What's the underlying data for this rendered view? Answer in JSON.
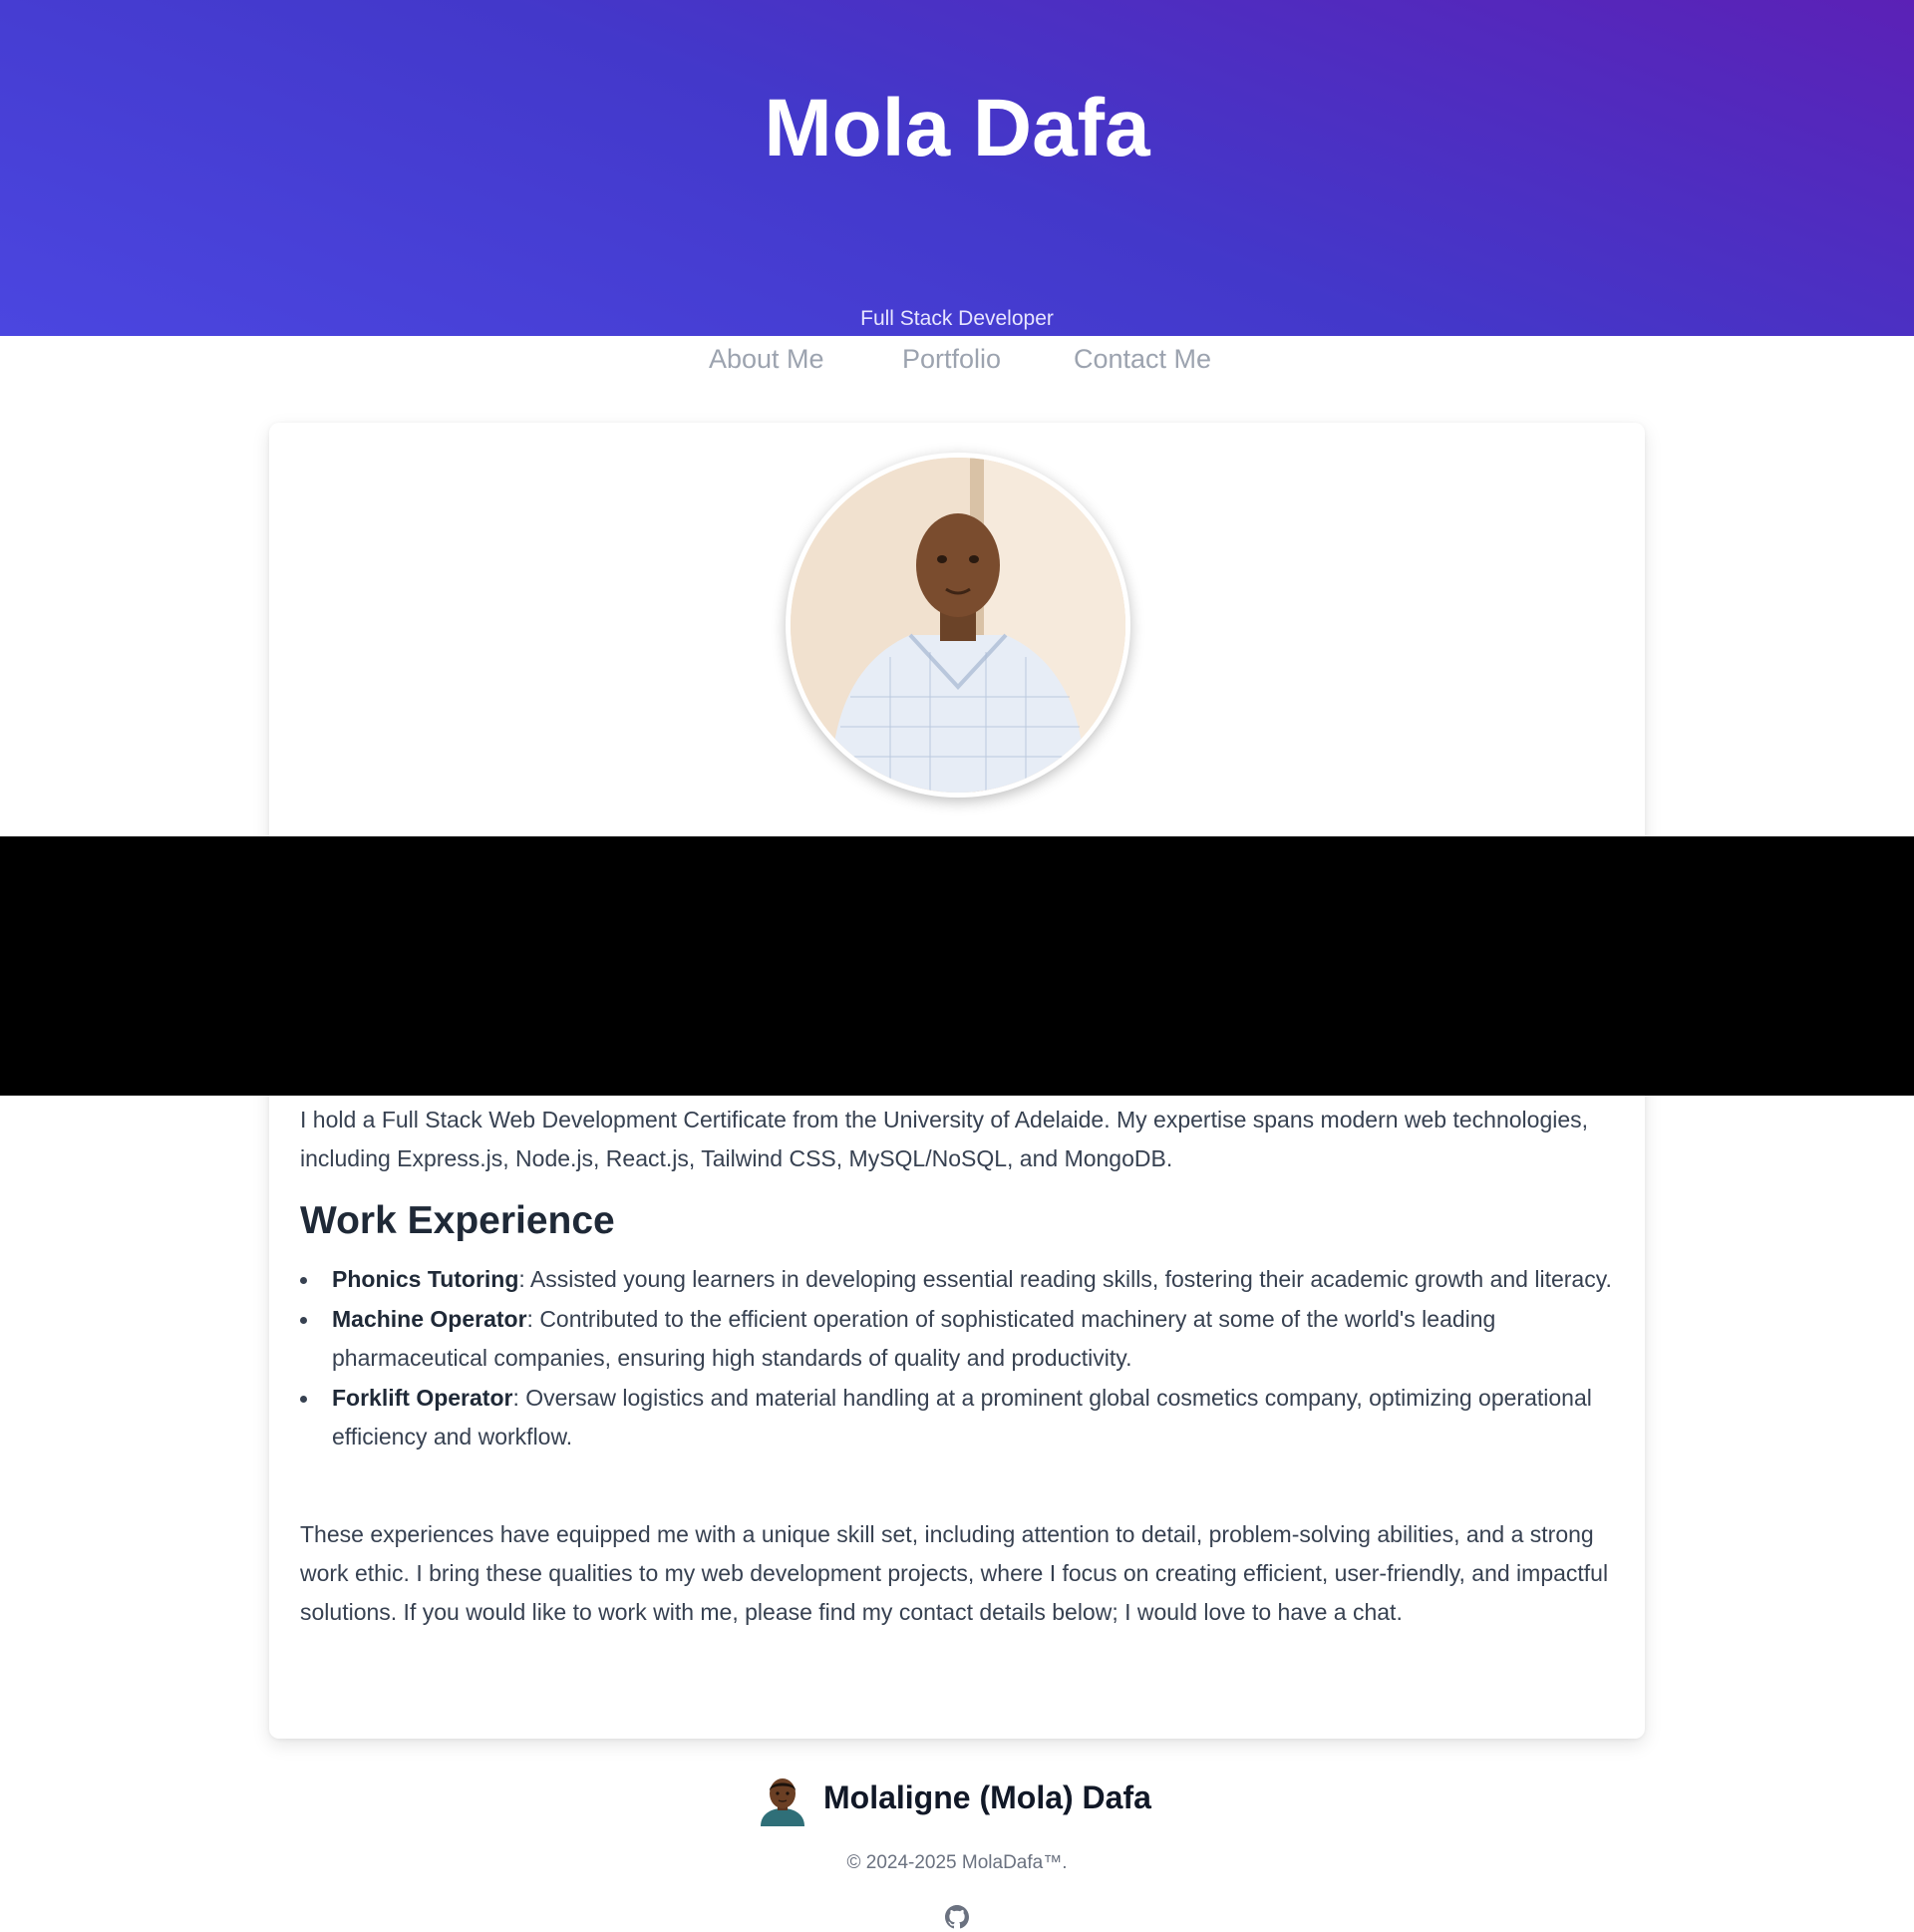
{
  "header": {
    "title": "Mola Dafa",
    "subtitle": "Full Stack Developer"
  },
  "nav": {
    "items": [
      {
        "label": "About Me"
      },
      {
        "label": "Portfolio"
      },
      {
        "label": "Contact Me"
      }
    ]
  },
  "about": {
    "intro": "I hold a Full Stack Web Development Certificate from the University of Adelaide. My expertise spans modern web technologies, including Express.js, Node.js, React.js, Tailwind CSS, MySQL/NoSQL, and MongoDB.",
    "work_heading": "Work Experience",
    "work_items": [
      {
        "role": "Phonics Tutoring",
        "description": ": Assisted young learners in developing essential reading skills, fostering their academic growth and literacy."
      },
      {
        "role": "Machine Operator",
        "description": ": Contributed to the efficient operation of sophisticated machinery at some of the world's leading pharmaceutical companies, ensuring high standards of quality and productivity."
      },
      {
        "role": "Forklift Operator",
        "description": ": Oversaw logistics and material handling at a prominent global cosmetics company, optimizing operational efficiency and workflow."
      }
    ],
    "closing": "These experiences have equipped me with a unique skill set, including attention to detail, problem-solving abilities, and a strong work ethic. I bring these qualities to my web development projects, where I focus on creating efficient, user-friendly, and impactful solutions. If you would like to work with me, please find my contact details below; I would love to have a chat."
  },
  "footer": {
    "name": "Molaligne (Mola) Dafa",
    "copyright": "© 2024-2025 MolaDafa™."
  },
  "icons": {
    "avatar": "profile-photo",
    "footer_avatar": "person-emoji-icon",
    "github": "github-icon"
  },
  "colors": {
    "hero_gradient_start": "#4b46e0",
    "hero_gradient_end": "#5b21b6",
    "nav_link": "#9ca3af",
    "body_text": "#374151",
    "heading_text": "#1f2937"
  }
}
